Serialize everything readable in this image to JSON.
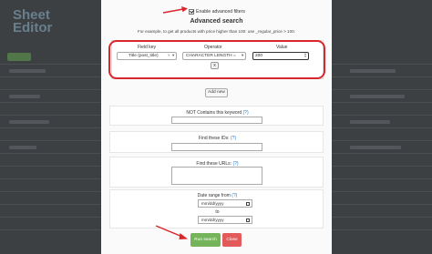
{
  "background_app": {
    "logo_text": "Sheet Editor"
  },
  "modal": {
    "enable_filters": {
      "label": "Enable advanced filters",
      "checked": true
    },
    "title": "Advanced search",
    "description": "For example, to get all products with price higher than 100: use _regular_price > 100.",
    "filter_row": {
      "field_key_header": "Field key",
      "operator_header": "Operator",
      "value_header": "Value",
      "field_key_value": "Title (post_title)",
      "operator_value": "CHARACTER LENGTH =",
      "value_value": "200",
      "remove_label": "x"
    },
    "add_new_label": "Add new",
    "not_contains": {
      "label": "NOT Contains this keyword",
      "help": "(?)"
    },
    "ids": {
      "label": "Find these IDs:",
      "help": "(?)"
    },
    "urls": {
      "label": "Find these URLs:",
      "help": "(?)"
    },
    "date_range": {
      "label": "Date range from",
      "help": "(?)",
      "from_placeholder": "mm/dd/yyyy",
      "to_label": "to",
      "to_placeholder": "mm/dd/yyyy"
    },
    "run_search_label": "Run search",
    "close_label": "Close"
  },
  "colors": {
    "run_search": "#76b45c",
    "close": "#e35a5a",
    "highlight": "#d9262c",
    "help_link": "#1a73c7"
  }
}
